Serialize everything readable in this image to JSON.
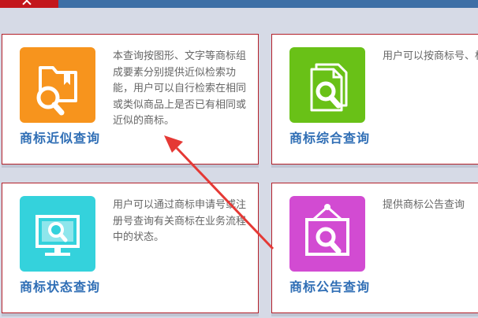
{
  "colors": {
    "topbar": "#3d6fa6",
    "home_tab": "#c3161c",
    "card_border": "#b3202a",
    "title": "#2f6eb5",
    "annotation_arrow": "#e53935"
  },
  "header": {
    "home_icon": "chevron-up-icon"
  },
  "cards": [
    {
      "title": "商标近似查询",
      "desc": "本查询按图形、文字等商标组成要素分别提供近似检索功能，用户可以自行检索在相同或类似商品上是否已有相同或近似的商标。",
      "icon": "folder-search-icon",
      "color": "#f7941d"
    },
    {
      "title": "商标综合查询",
      "desc": "用户可以按商标号、标、申请人名称等查询某一商标的有息。",
      "icon": "documents-search-icon",
      "color": "#69c117"
    },
    {
      "title": "商标状态查询",
      "desc": "用户可以通过商标申请号或注册号查询有关商标在业务流程中的状态。",
      "icon": "monitor-search-icon",
      "color": "#34d2dc"
    },
    {
      "title": "商标公告查询",
      "desc": "提供商标公告查询",
      "icon": "frame-search-icon",
      "color": "#d24bd2"
    }
  ]
}
